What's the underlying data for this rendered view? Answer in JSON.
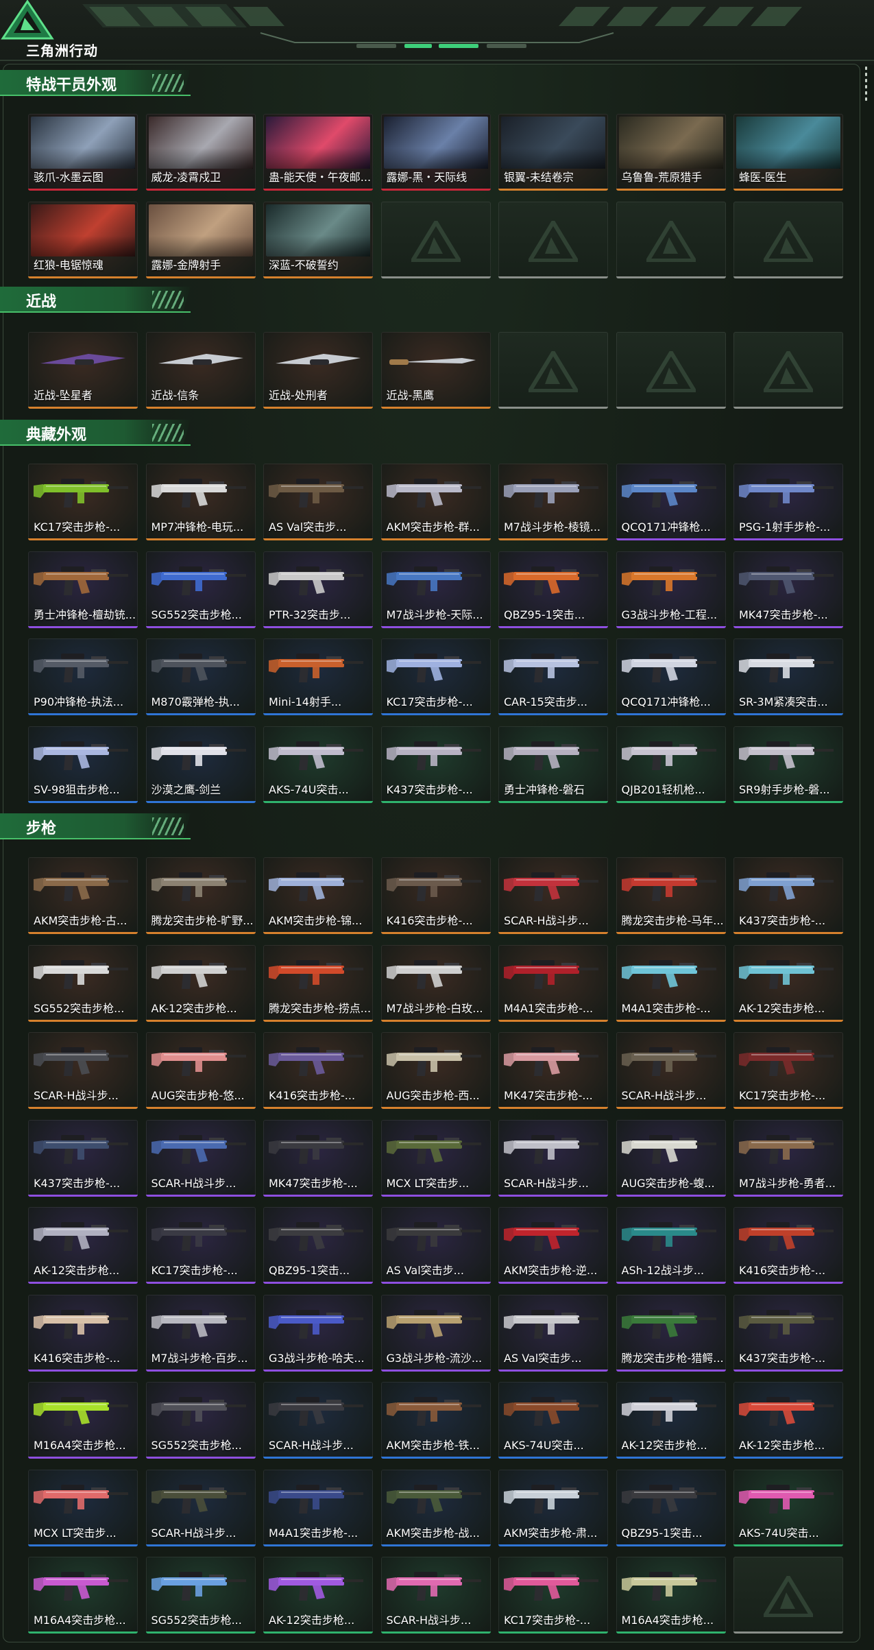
{
  "header": {
    "brand": "三角洲行动"
  },
  "colors": {
    "accent_green": "#48c06a",
    "rarity": {
      "gold": "#d6812d",
      "purple": "#8e4fe0",
      "blue": "#2f75d6",
      "green": "#2fb36d",
      "red": "#c9283a",
      "grey": "#8a8f8a"
    },
    "card_bg": {
      "gold": "#3a2a22",
      "purple": "#2b2540",
      "blue": "#1e2a3c",
      "green": "#1f3a2c",
      "red": "#3a1f25",
      "grey": "#1f2a21"
    }
  },
  "sections": [
    {
      "title": "特战干员外观",
      "items": [
        {
          "name": "骇爪-水墨云图",
          "rarity": "red",
          "kind": "operator",
          "icon": "operator-portrait-icon"
        },
        {
          "name": "威龙-凌霄戍卫",
          "rarity": "red",
          "kind": "operator",
          "icon": "operator-portrait-icon"
        },
        {
          "name": "蛊-能天使・午夜邮...",
          "rarity": "red",
          "kind": "operator",
          "icon": "operator-portrait-icon"
        },
        {
          "name": "露娜-黑・天际线",
          "rarity": "red",
          "kind": "operator",
          "icon": "operator-portrait-icon"
        },
        {
          "name": "银翼-未结卷宗",
          "rarity": "gold",
          "kind": "operator",
          "icon": "operator-portrait-icon"
        },
        {
          "name": "乌鲁鲁-荒原猎手",
          "rarity": "gold",
          "kind": "operator",
          "icon": "operator-portrait-icon"
        },
        {
          "name": "蜂医-医生",
          "rarity": "gold",
          "kind": "operator",
          "icon": "operator-portrait-icon"
        },
        {
          "name": "红狼-电锯惊魂",
          "rarity": "gold",
          "kind": "operator",
          "icon": "operator-portrait-icon"
        },
        {
          "name": "露娜-金牌射手",
          "rarity": "gold",
          "kind": "operator",
          "icon": "operator-portrait-icon"
        },
        {
          "name": "深蓝-不破誓约",
          "rarity": "gold",
          "kind": "operator",
          "icon": "operator-portrait-icon"
        },
        {
          "empty": true
        },
        {
          "empty": true
        },
        {
          "empty": true
        },
        {
          "empty": true
        }
      ]
    },
    {
      "title": "近战",
      "items": [
        {
          "name": "近战-坠星者",
          "rarity": "gold",
          "kind": "melee",
          "icon": "blade-icon"
        },
        {
          "name": "近战-信条",
          "rarity": "gold",
          "kind": "melee",
          "icon": "blade-icon"
        },
        {
          "name": "近战-处刑者",
          "rarity": "gold",
          "kind": "melee",
          "icon": "blade-icon"
        },
        {
          "name": "近战-黑鹰",
          "rarity": "gold",
          "kind": "melee",
          "icon": "blade-icon"
        },
        {
          "empty": true
        },
        {
          "empty": true
        },
        {
          "empty": true
        }
      ]
    },
    {
      "title": "典藏外观",
      "items": [
        {
          "name": "KC17突击步枪-...",
          "rarity": "gold",
          "kind": "gun",
          "tint": "#7fbf2a"
        },
        {
          "name": "MP7冲锋枪-电玩...",
          "rarity": "gold",
          "kind": "gun",
          "tint": "#d9d9d9"
        },
        {
          "name": "AS Val突击步...",
          "rarity": "gold",
          "kind": "gun",
          "tint": "#6d5a44"
        },
        {
          "name": "AKM突击步枪-群...",
          "rarity": "gold",
          "kind": "gun",
          "tint": "#b9b9c9"
        },
        {
          "name": "M7战斗步枪-棱镜...",
          "rarity": "gold",
          "kind": "gun",
          "tint": "#9aa0b8"
        },
        {
          "name": "QCQ171冲锋枪...",
          "rarity": "purple",
          "kind": "gun",
          "tint": "#5b86c8"
        },
        {
          "name": "PSG-1射手步枪-...",
          "rarity": "purple",
          "kind": "gun",
          "tint": "#6f87c9"
        },
        {
          "name": "勇士冲锋枪-檀劫铳...",
          "rarity": "purple",
          "kind": "gun",
          "tint": "#a0683a"
        },
        {
          "name": "SG552突击步枪...",
          "rarity": "purple",
          "kind": "gun",
          "tint": "#3f6bd0"
        },
        {
          "name": "PTR-32突击步...",
          "rarity": "purple",
          "kind": "gun",
          "tint": "#c9c9c9"
        },
        {
          "name": "M7战斗步枪-天际...",
          "rarity": "purple",
          "kind": "gun",
          "tint": "#4777c2"
        },
        {
          "name": "QBZ95-1突击...",
          "rarity": "purple",
          "kind": "gun",
          "tint": "#d9692a"
        },
        {
          "name": "G3战斗步枪-工程...",
          "rarity": "purple",
          "kind": "gun",
          "tint": "#d9772a"
        },
        {
          "name": "MK47突击步枪-...",
          "rarity": "purple",
          "kind": "gun",
          "tint": "#4f5770"
        },
        {
          "name": "P90冲锋枪-执法...",
          "rarity": "blue",
          "kind": "gun",
          "tint": "#555b66"
        },
        {
          "name": "M870霰弹枪-执...",
          "rarity": "blue",
          "kind": "gun",
          "tint": "#4e535c"
        },
        {
          "name": "Mini-14射手...",
          "rarity": "blue",
          "kind": "gun",
          "tint": "#c9602c"
        },
        {
          "name": "KC17突击步枪-...",
          "rarity": "blue",
          "kind": "gun",
          "tint": "#9fb1e0"
        },
        {
          "name": "CAR-15突击步...",
          "rarity": "blue",
          "kind": "gun",
          "tint": "#b7c2e0"
        },
        {
          "name": "QCQ171冲锋枪...",
          "rarity": "blue",
          "kind": "gun",
          "tint": "#d0d4e0"
        },
        {
          "name": "SR-3M紧凑突击...",
          "rarity": "blue",
          "kind": "gun",
          "tint": "#d8dbe2"
        },
        {
          "name": "SV-98狙击步枪...",
          "rarity": "blue",
          "kind": "gun",
          "tint": "#aab7e0"
        },
        {
          "name": "沙漠之鹰-剑兰",
          "rarity": "blue",
          "kind": "gun",
          "tint": "#e0e0e8"
        },
        {
          "name": "AKS-74U突击...",
          "rarity": "green",
          "kind": "gun",
          "tint": "#c0bccd"
        },
        {
          "name": "K437突击步枪-...",
          "rarity": "green",
          "kind": "gun",
          "tint": "#b7b2c3"
        },
        {
          "name": "勇士冲锋枪-磐石",
          "rarity": "green",
          "kind": "gun",
          "tint": "#b5b0c0"
        },
        {
          "name": "QJB201轻机枪...",
          "rarity": "green",
          "kind": "gun",
          "tint": "#c7c3d0"
        },
        {
          "name": "SR9射手步枪-磐...",
          "rarity": "green",
          "kind": "gun",
          "tint": "#c4c0cc"
        }
      ]
    },
    {
      "title": "步枪",
      "items": [
        {
          "name": "AKM突击步枪-古...",
          "rarity": "gold",
          "kind": "gun",
          "tint": "#8a6a4a"
        },
        {
          "name": "腾龙突击步枪-旷野...",
          "rarity": "gold",
          "kind": "gun",
          "tint": "#8c8272"
        },
        {
          "name": "AKM突击步枪-锦...",
          "rarity": "gold",
          "kind": "gun",
          "tint": "#9fb0d8"
        },
        {
          "name": "K416突击步枪-...",
          "rarity": "gold",
          "kind": "gun",
          "tint": "#6b5a4c"
        },
        {
          "name": "SCAR-H战斗步...",
          "rarity": "gold",
          "kind": "gun",
          "tint": "#c2323c"
        },
        {
          "name": "腾龙突击步枪-马年...",
          "rarity": "gold",
          "kind": "gun",
          "tint": "#c53a30"
        },
        {
          "name": "K437突击步枪-...",
          "rarity": "gold",
          "kind": "gun",
          "tint": "#7fa0d0"
        },
        {
          "name": "SG552突击步枪...",
          "rarity": "gold",
          "kind": "gun",
          "tint": "#d9d9d9"
        },
        {
          "name": "AK-12突击步枪...",
          "rarity": "gold",
          "kind": "gun",
          "tint": "#d0d0d0"
        },
        {
          "name": "腾龙突击步枪-捞点...",
          "rarity": "gold",
          "kind": "gun",
          "tint": "#d24a2a"
        },
        {
          "name": "M7战斗步枪-白玫...",
          "rarity": "gold",
          "kind": "gun",
          "tint": "#cfcfcf"
        },
        {
          "name": "M4A1突击步枪-...",
          "rarity": "gold",
          "kind": "gun",
          "tint": "#b0202a"
        },
        {
          "name": "M4A1突击步枪-...",
          "rarity": "gold",
          "kind": "gun",
          "tint": "#6fc4d8"
        },
        {
          "name": "AK-12突击步枪...",
          "rarity": "gold",
          "kind": "gun",
          "tint": "#6fc2d4"
        },
        {
          "name": "SCAR-H战斗步...",
          "rarity": "gold",
          "kind": "gun",
          "tint": "#4a4c52"
        },
        {
          "name": "AUG突击步枪-悠...",
          "rarity": "gold",
          "kind": "gun",
          "tint": "#e08e8e"
        },
        {
          "name": "K416突击步枪-...",
          "rarity": "gold",
          "kind": "gun",
          "tint": "#6a5a9a"
        },
        {
          "name": "AUG突击步枪-西...",
          "rarity": "gold",
          "kind": "gun",
          "tint": "#c8c0a8"
        },
        {
          "name": "MK47突击步枪-...",
          "rarity": "gold",
          "kind": "gun",
          "tint": "#d89aa0"
        },
        {
          "name": "SCAR-H战斗步...",
          "rarity": "gold",
          "kind": "gun",
          "tint": "#6a6050"
        },
        {
          "name": "KC17突击步枪-...",
          "rarity": "gold",
          "kind": "gun",
          "tint": "#7a2a2a"
        },
        {
          "name": "K437突击步枪-...",
          "rarity": "purple",
          "kind": "gun",
          "tint": "#3e4e6e"
        },
        {
          "name": "SCAR-H战斗步...",
          "rarity": "purple",
          "kind": "gun",
          "tint": "#4a6ab0"
        },
        {
          "name": "MK47突击步枪-...",
          "rarity": "purple",
          "kind": "gun",
          "tint": "#3a3a40"
        },
        {
          "name": "MCX LT突击步...",
          "rarity": "purple",
          "kind": "gun",
          "tint": "#5a6a3a"
        },
        {
          "name": "SCAR-H战斗步...",
          "rarity": "purple",
          "kind": "gun",
          "tint": "#bfbfc8"
        },
        {
          "name": "AUG突击步枪-蝮...",
          "rarity": "purple",
          "kind": "gun",
          "tint": "#d8d8d0"
        },
        {
          "name": "M7战斗步枪-勇者...",
          "rarity": "purple",
          "kind": "gun",
          "tint": "#8a6a4c"
        },
        {
          "name": "AK-12突击步枪...",
          "rarity": "purple",
          "kind": "gun",
          "tint": "#b0b0c0"
        },
        {
          "name": "KC17突击步枪-...",
          "rarity": "purple",
          "kind": "gun",
          "tint": "#3a3a44"
        },
        {
          "name": "QBZ95-1突击...",
          "rarity": "purple",
          "kind": "gun",
          "tint": "#3c3c40"
        },
        {
          "name": "AS Val突击步...",
          "rarity": "purple",
          "kind": "gun",
          "tint": "#3a3a3c"
        },
        {
          "name": "AKM突击步枪-逆...",
          "rarity": "purple",
          "kind": "gun",
          "tint": "#c0242c"
        },
        {
          "name": "ASh-12战斗步...",
          "rarity": "purple",
          "kind": "gun",
          "tint": "#2a8a8a"
        },
        {
          "name": "K416突击步枪-...",
          "rarity": "purple",
          "kind": "gun",
          "tint": "#c0402a"
        },
        {
          "name": "K416突击步枪-...",
          "rarity": "purple",
          "kind": "gun",
          "tint": "#d8c0a8"
        },
        {
          "name": "M7战斗步枪-百步...",
          "rarity": "purple",
          "kind": "gun",
          "tint": "#b8b8c0"
        },
        {
          "name": "G3战斗步枪-哈夫...",
          "rarity": "purple",
          "kind": "gun",
          "tint": "#4a5ac8"
        },
        {
          "name": "G3战斗步枪-流沙...",
          "rarity": "purple",
          "kind": "gun",
          "tint": "#b8a070"
        },
        {
          "name": "AS Val突击步...",
          "rarity": "purple",
          "kind": "gun",
          "tint": "#c8c8cc"
        },
        {
          "name": "腾龙突击步枪-猎鳄...",
          "rarity": "purple",
          "kind": "gun",
          "tint": "#3a7a3a"
        },
        {
          "name": "K437突击步枪-...",
          "rarity": "purple",
          "kind": "gun",
          "tint": "#5a5a40"
        },
        {
          "name": "M16A4突击步枪...",
          "rarity": "purple",
          "kind": "gun",
          "tint": "#a8e02a"
        },
        {
          "name": "SG552突击步枪...",
          "rarity": "purple",
          "kind": "gun",
          "tint": "#505058"
        },
        {
          "name": "SCAR-H战斗步...",
          "rarity": "blue",
          "kind": "gun",
          "tint": "#3a3a40"
        },
        {
          "name": "AKM突击步枪-铁...",
          "rarity": "blue",
          "kind": "gun",
          "tint": "#8a5a3a"
        },
        {
          "name": "AKS-74U突击...",
          "rarity": "blue",
          "kind": "gun",
          "tint": "#8a4a2a"
        },
        {
          "name": "AK-12突击步枪...",
          "rarity": "blue",
          "kind": "gun",
          "tint": "#d0d0d8"
        },
        {
          "name": "AK-12突击步枪...",
          "rarity": "blue",
          "kind": "gun",
          "tint": "#d84a3a"
        },
        {
          "name": "MCX LT突击步...",
          "rarity": "blue",
          "kind": "gun",
          "tint": "#e06a6a"
        },
        {
          "name": "SCAR-H战斗步...",
          "rarity": "blue",
          "kind": "gun",
          "tint": "#4a4e3a"
        },
        {
          "name": "M4A1突击步枪-...",
          "rarity": "blue",
          "kind": "gun",
          "tint": "#3a4a8a"
        },
        {
          "name": "AKM突击步枪-战...",
          "rarity": "blue",
          "kind": "gun",
          "tint": "#4a5a3a"
        },
        {
          "name": "AKM突击步枪-肃...",
          "rarity": "blue",
          "kind": "gun",
          "tint": "#c8d0d8"
        },
        {
          "name": "QBZ95-1突击...",
          "rarity": "blue",
          "kind": "gun",
          "tint": "#3a3a3e"
        },
        {
          "name": "AKS-74U突击...",
          "rarity": "green",
          "kind": "gun",
          "tint": "#e05ab0"
        },
        {
          "name": "M16A4突击步枪...",
          "rarity": "green",
          "kind": "gun",
          "tint": "#c85ad0"
        },
        {
          "name": "SG552突击步枪...",
          "rarity": "green",
          "kind": "gun",
          "tint": "#6aa0e0"
        },
        {
          "name": "AK-12突击步枪...",
          "rarity": "green",
          "kind": "gun",
          "tint": "#a05ae0"
        },
        {
          "name": "SCAR-H战斗步...",
          "rarity": "green",
          "kind": "gun",
          "tint": "#e06ab0"
        },
        {
          "name": "KC17突击步枪-...",
          "rarity": "green",
          "kind": "gun",
          "tint": "#e05a9a"
        },
        {
          "name": "M16A4突击步枪...",
          "rarity": "green",
          "kind": "gun",
          "tint": "#c8c89a"
        },
        {
          "empty": true
        }
      ]
    }
  ]
}
